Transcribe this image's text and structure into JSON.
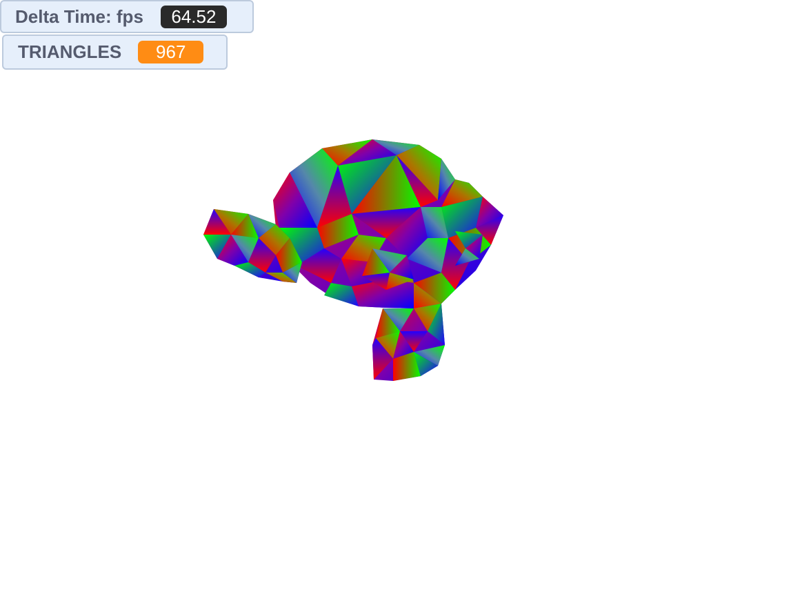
{
  "hud": {
    "fps_label": "Delta Time: fps",
    "fps_value": "64.52",
    "triangles_label": "TRIANGLES",
    "triangles_value": "967"
  },
  "colors": {
    "hud_background": "#e6effb",
    "hud_border": "#bccadd",
    "label_text": "#555b6e",
    "fps_badge": "#2a2a2a",
    "triangles_badge": "#ff8c14",
    "vertex_red": "#ff0000",
    "vertex_green": "#00ff00",
    "vertex_blue": "#0000ff"
  },
  "scene": {
    "model": "monkey-head",
    "shading": "per-vertex RGB gradient",
    "background": "#ffffff"
  }
}
